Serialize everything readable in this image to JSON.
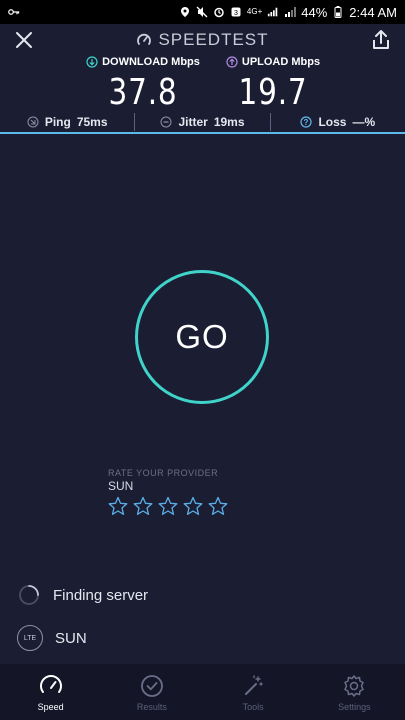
{
  "status_bar": {
    "network_tag": "4G+",
    "battery_percent": "44%",
    "time": "2:44 AM"
  },
  "header": {
    "brand": "SPEEDTEST"
  },
  "results": {
    "download": {
      "label": "DOWNLOAD Mbps",
      "value": "37.8"
    },
    "upload": {
      "label": "UPLOAD Mbps",
      "value": "19.7"
    }
  },
  "metrics": {
    "ping": {
      "label": "Ping",
      "value": "75ms"
    },
    "jitter": {
      "label": "Jitter",
      "value": "19ms"
    },
    "loss": {
      "label": "Loss",
      "value": "—%"
    }
  },
  "go_button": {
    "label": "GO"
  },
  "rating": {
    "heading": "RATE YOUR PROVIDER",
    "provider": "SUN",
    "star_count": 5
  },
  "server": {
    "finding": "Finding server",
    "network_badge": "LTE",
    "provider": "SUN"
  },
  "nav": {
    "items": [
      {
        "label": "Speed",
        "icon": "speed-gauge-icon",
        "active": true
      },
      {
        "label": "Results",
        "icon": "results-check-icon",
        "active": false
      },
      {
        "label": "Tools",
        "icon": "tools-wand-icon",
        "active": false
      },
      {
        "label": "Settings",
        "icon": "settings-gear-icon",
        "active": false
      }
    ]
  },
  "colors": {
    "background": "#1b1d33",
    "accent_teal": "#3fd3c9",
    "accent_blue": "#5fb9e8",
    "upload_purple": "#b08be0",
    "star_blue": "#5aaee6"
  }
}
